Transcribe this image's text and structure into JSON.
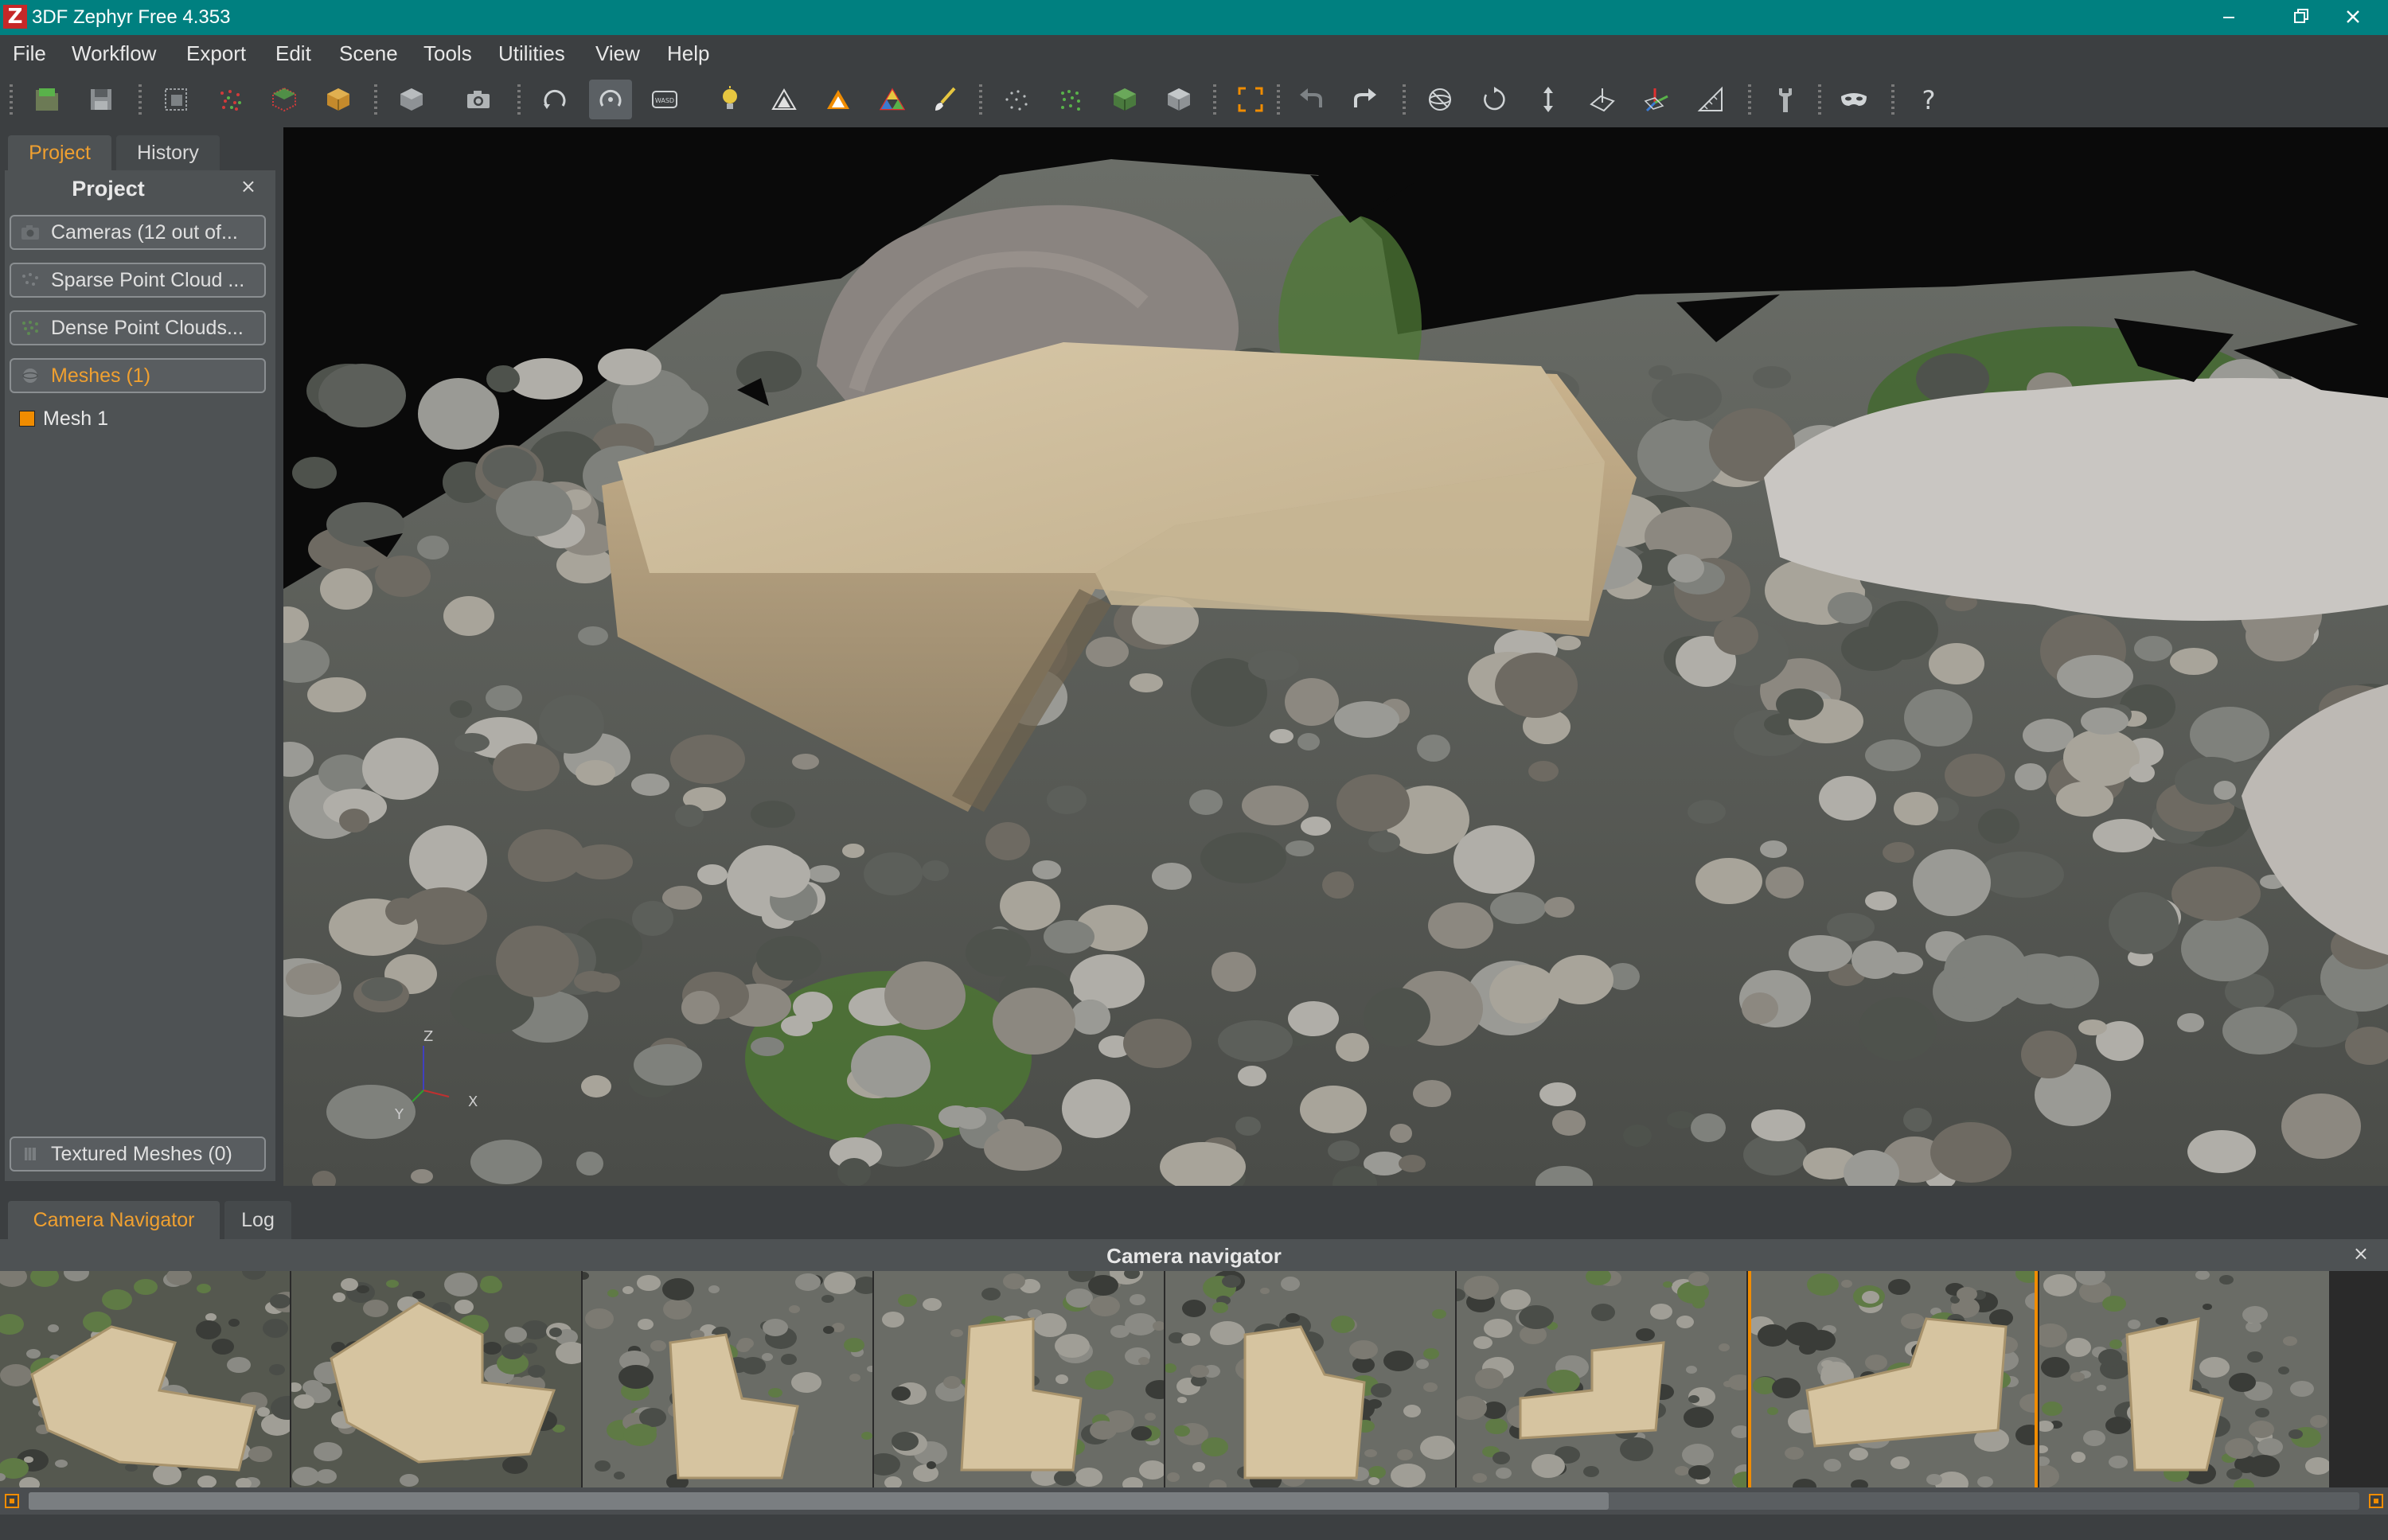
{
  "window": {
    "title": "3DF Zephyr Free 4.353",
    "logo_letter": "Z"
  },
  "menu": [
    "File",
    "Workflow",
    "Export",
    "Edit",
    "Scene",
    "Tools",
    "Utilities",
    "View",
    "Help"
  ],
  "left_panel": {
    "tabs": {
      "project": "Project",
      "history": "History"
    },
    "title": "Project",
    "close_glyph": "×",
    "items": {
      "cameras": "Cameras (12 out of...",
      "sparse": "Sparse Point Cloud ...",
      "dense": "Dense Point Clouds...",
      "meshes": "Meshes (1)",
      "mesh1": "Mesh 1",
      "textured": "Textured Meshes (0)"
    }
  },
  "viewport": {
    "axis": {
      "z": "Z",
      "x": "X",
      "y": "Y"
    }
  },
  "bottom": {
    "tabs": {
      "navigator": "Camera Navigator",
      "log": "Log"
    },
    "title": "Camera navigator",
    "close_glyph": "×"
  },
  "colors": {
    "accent": "#f08c00",
    "titlebar": "#008080",
    "panel": "#4e5254"
  }
}
